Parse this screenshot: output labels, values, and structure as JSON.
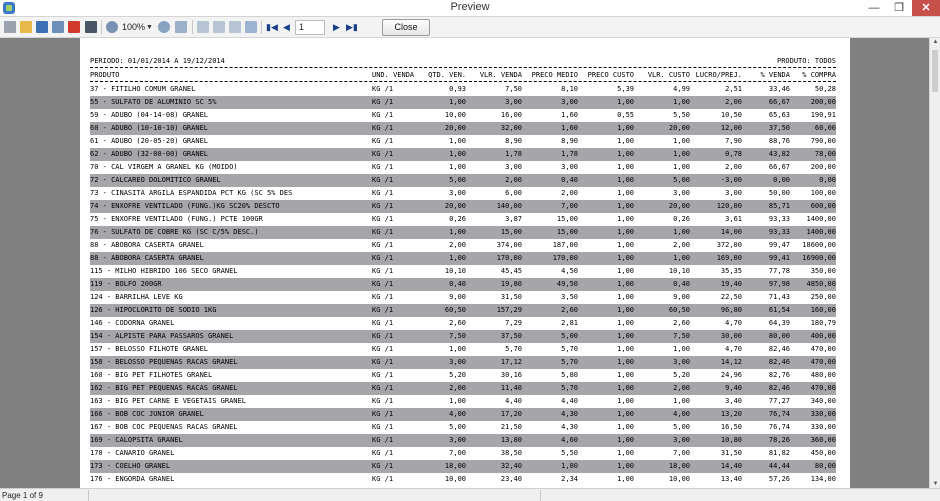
{
  "window": {
    "title": "Preview"
  },
  "toolbar": {
    "zoom": "100%",
    "page_number": "1",
    "close_label": "Close"
  },
  "report": {
    "period": "PERIODO: 01/01/2014 A 19/12/2014",
    "product_filter": "PRODUTO: TODOS",
    "columns": {
      "produto": "PRODUTO",
      "unid": "UND. VENDA",
      "qtd": "QTD. VEN.",
      "vlr_venda": "VLR. VENDA",
      "preco_medio": "PRECO MEDIO",
      "preco_custo": "PRECO CUSTO",
      "vlr_custo": "VLR. CUSTO",
      "lucro": "LUCRO/PREJ.",
      "pct_venda": "% VENDA",
      "pct_compra": "% COMPRA"
    },
    "rows": [
      [
        "37 - FITILHO COMUM GRANEL",
        "KG /1",
        "0,93",
        "7,50",
        "8,10",
        "5,39",
        "4,99",
        "2,51",
        "33,46",
        "50,28"
      ],
      [
        "55 - SULFATO DE ALUMINIO SC 5%",
        "KG /1",
        "1,00",
        "3,00",
        "3,00",
        "1,00",
        "1,00",
        "2,00",
        "66,67",
        "200,00"
      ],
      [
        "59 - ADUBO (04-14-08) GRANEL",
        "KG /1",
        "10,00",
        "16,00",
        "1,60",
        "0,55",
        "5,50",
        "10,50",
        "65,63",
        "190,91"
      ],
      [
        "60 - ADUBO (10-10-10) GRANEL",
        "KG /1",
        "20,00",
        "32,00",
        "1,60",
        "1,00",
        "20,00",
        "12,00",
        "37,50",
        "60,00"
      ],
      [
        "61 - ADUBO (20-05-20) GRANEL",
        "KG /1",
        "1,00",
        "8,90",
        "8,90",
        "1,00",
        "1,00",
        "7,90",
        "88,76",
        "790,00"
      ],
      [
        "62 - ADUBO (32-00-00) GRANEL",
        "KG /1",
        "1,00",
        "1,78",
        "1,78",
        "1,00",
        "1,00",
        "0,78",
        "43,82",
        "78,00"
      ],
      [
        "70 - CAL VIRGEM A GRANEL KG (MOIDO)",
        "KG /1",
        "1,00",
        "3,00",
        "3,00",
        "1,00",
        "1,00",
        "2,00",
        "66,67",
        "200,00"
      ],
      [
        "72 - CALCAREO DOLOMITICO GRANEL",
        "KG /1",
        "5,00",
        "2,00",
        "0,40",
        "1,00",
        "5,00",
        "-3,00",
        "0,00",
        "0,00"
      ],
      [
        "73 - CINASITA ARGILA ESPANDIDA PCT  KG (SC 5% DES",
        "KG /1",
        "3,00",
        "6,00",
        "2,00",
        "1,00",
        "3,00",
        "3,00",
        "50,00",
        "100,00"
      ],
      [
        "74 - ENXOFRE VENTILADO (FUNG.)KG SC20% DESCTO",
        "KG /1",
        "20,00",
        "140,00",
        "7,00",
        "1,00",
        "20,00",
        "120,00",
        "85,71",
        "600,00"
      ],
      [
        "75 - ENXOFRE VENTILADO (FUNG.) PCTE 100GR",
        "KG /1",
        "0,26",
        "3,87",
        "15,00",
        "1,00",
        "0,26",
        "3,61",
        "93,33",
        "1400,00"
      ],
      [
        "76 - SULFATO DE COBRE  KG (SC C/5% DESC.)",
        "KG /1",
        "1,00",
        "15,00",
        "15,00",
        "1,00",
        "1,00",
        "14,00",
        "93,33",
        "1400,00"
      ],
      [
        "88 - ABOBORA CASERTA GRANEL",
        "KG /1",
        "2,00",
        "374,00",
        "187,00",
        "1,00",
        "2,00",
        "372,00",
        "99,47",
        "18600,00"
      ],
      [
        "88 - ABOBORA CASERTA GRANEL",
        "KG /1",
        "1,00",
        "170,00",
        "170,00",
        "1,00",
        "1,00",
        "169,00",
        "99,41",
        "16900,00"
      ],
      [
        "115 - MILHO HIBRIDO 106 SECO GRANEL",
        "KG /1",
        "10,10",
        "45,45",
        "4,50",
        "1,00",
        "10,10",
        "35,35",
        "77,78",
        "350,00"
      ],
      [
        "119 - BOLFO 200GR",
        "KG /1",
        "0,40",
        "19,80",
        "49,50",
        "1,00",
        "0,40",
        "19,40",
        "97,98",
        "4850,00"
      ],
      [
        "124 - BARRILHA LEVE KG",
        "KG /1",
        "9,00",
        "31,50",
        "3,50",
        "1,00",
        "9,00",
        "22,50",
        "71,43",
        "250,00"
      ],
      [
        "126 - HIPOCLORITO DE SODIO 1KG",
        "KG /1",
        "60,50",
        "157,29",
        "2,60",
        "1,00",
        "60,50",
        "96,80",
        "61,54",
        "160,00"
      ],
      [
        "146 - CODORNA GRANEL",
        "KG /1",
        "2,60",
        "7,29",
        "2,81",
        "1,00",
        "2,60",
        "4,70",
        "64,39",
        "180,79"
      ],
      [
        "154 - ALPISTE PARA PASSAROS GRANEL",
        "KG /1",
        "7,50",
        "37,50",
        "5,00",
        "1,00",
        "7,50",
        "30,00",
        "80,00",
        "400,00"
      ],
      [
        "157 - BELOSSO FILHOTE GRANEL",
        "KG /1",
        "1,00",
        "5,70",
        "5,70",
        "1,00",
        "1,00",
        "4,70",
        "82,46",
        "470,00"
      ],
      [
        "158 - BELOSSO PEQUENAS RACAS GRANEL",
        "KG /1",
        "3,00",
        "17,12",
        "5,70",
        "1,00",
        "3,00",
        "14,12",
        "82,46",
        "470,00"
      ],
      [
        "160 - BIG PET FILHOTES GRANEL",
        "KG /1",
        "5,20",
        "30,16",
        "5,80",
        "1,00",
        "5,20",
        "24,96",
        "82,76",
        "480,00"
      ],
      [
        "162 - BIG PET PEQUENAS RACAS GRANEL",
        "KG /1",
        "2,00",
        "11,40",
        "5,70",
        "1,00",
        "2,00",
        "9,40",
        "82,46",
        "470,00"
      ],
      [
        "163 - BIG PET CARNE E VEGETAIS GRANEL",
        "KG /1",
        "1,00",
        "4,40",
        "4,40",
        "1,00",
        "1,00",
        "3,40",
        "77,27",
        "340,00"
      ],
      [
        "166 - BOB COC JUNIOR GRANEL",
        "KG /1",
        "4,00",
        "17,20",
        "4,30",
        "1,00",
        "4,00",
        "13,20",
        "76,74",
        "330,00"
      ],
      [
        "167 - BOB COC PEQUENAS RACAS GRANEL",
        "KG /1",
        "5,00",
        "21,50",
        "4,30",
        "1,00",
        "5,00",
        "16,50",
        "76,74",
        "330,00"
      ],
      [
        "169 - CALOPSITA GRANEL",
        "KG /1",
        "3,00",
        "13,80",
        "4,60",
        "1,00",
        "3,00",
        "10,80",
        "78,26",
        "360,00"
      ],
      [
        "170 - CANARIO GRANEL",
        "KG /1",
        "7,00",
        "38,50",
        "5,50",
        "1,00",
        "7,00",
        "31,50",
        "81,82",
        "450,00"
      ],
      [
        "173 - COELHO GRANEL",
        "KG /1",
        "18,00",
        "32,40",
        "1,80",
        "1,00",
        "18,00",
        "14,40",
        "44,44",
        "80,00"
      ],
      [
        "176 - ENGORDA GRANEL",
        "KG /1",
        "10,00",
        "23,40",
        "2,34",
        "1,00",
        "10,00",
        "13,40",
        "57,26",
        "134,00"
      ]
    ]
  },
  "status": {
    "page_label": "Page 1 of 9"
  }
}
